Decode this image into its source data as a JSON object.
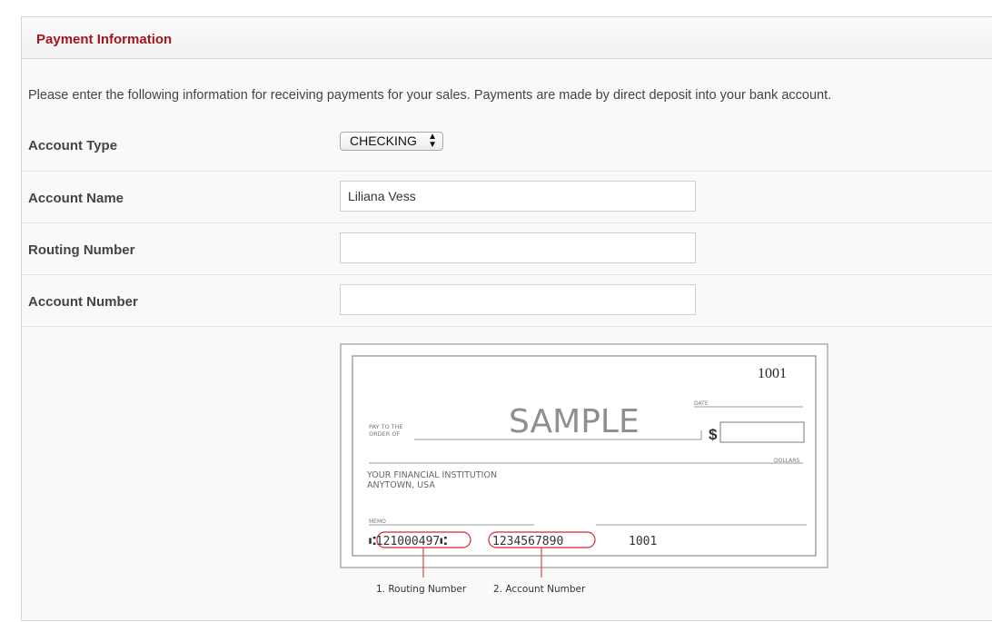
{
  "panel": {
    "title": "Payment Information",
    "intro": "Please enter the following information for receiving payments for your sales. Payments are made by direct deposit into your bank account."
  },
  "form": {
    "account_type": {
      "label": "Account Type",
      "value": "CHECKING"
    },
    "account_name": {
      "label": "Account Name",
      "value": "Liliana Vess",
      "placeholder": ""
    },
    "routing_number": {
      "label": "Routing Number",
      "value": "",
      "placeholder": ""
    },
    "account_number": {
      "label": "Account Number",
      "value": "",
      "placeholder": ""
    }
  },
  "check_image": {
    "check_number": "1001",
    "date_label": "DATE",
    "pay_to_line1": "PAY TO THE",
    "pay_to_line2": "ORDER OF",
    "sample_text": "SAMPLE",
    "dollar_sign": "$",
    "dollars_label": "DOLLARS",
    "institution_line1": "YOUR FINANCIAL INSTITUTION",
    "institution_line2": "ANYTOWN, USA",
    "memo_label": "MEMO",
    "routing_digits": "⑆121000497⑆",
    "account_digits": "1234567890",
    "check_digits": "1001",
    "callout_routing": "1. Routing Number",
    "callout_account": "2. Account Number",
    "accent_color": "#d9262e"
  }
}
